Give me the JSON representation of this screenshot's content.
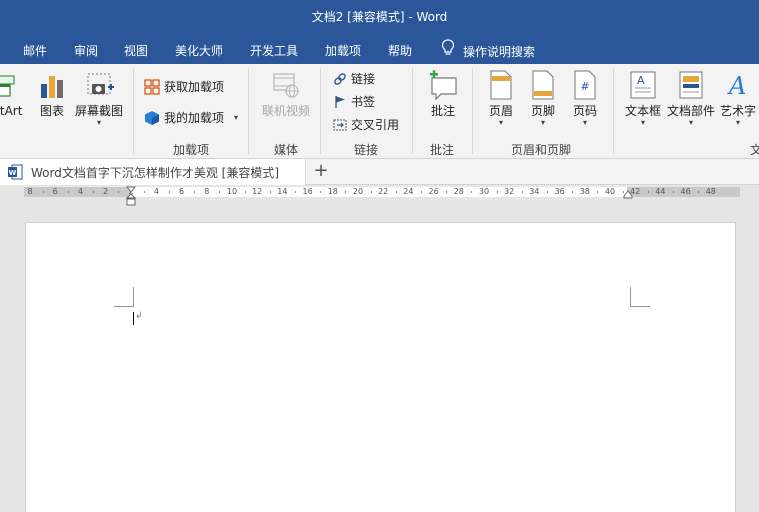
{
  "titlebar": {
    "title": "文档2 [兼容模式]  -  Word"
  },
  "tabs": [
    "邮件",
    "审阅",
    "视图",
    "美化大师",
    "开发工具",
    "加载项",
    "帮助"
  ],
  "tell_me": "操作说明搜索",
  "ribbon": {
    "smartart_partial": "artArt",
    "chart": "图表",
    "screenshot": "屏幕截图",
    "get_addins": "获取加载项",
    "my_addins": "我的加载项",
    "group_addins": "加载项",
    "online_video": "联机视频",
    "group_media": "媒体",
    "link": "链接",
    "bookmark": "书签",
    "cross_reference": "交叉引用",
    "group_links": "链接",
    "comment": "批注",
    "group_comments": "批注",
    "header": "页眉",
    "footer": "页脚",
    "page_number": "页码",
    "group_header_footer": "页眉和页脚",
    "textbox": "文本框",
    "quick_parts": "文档部件",
    "wordart": "艺术字",
    "group_text_partial": "文"
  },
  "document_tab": {
    "label": "Word文档首字下沉怎样制作才美观 [兼容模式]",
    "add": "+"
  },
  "ruler_labels": [
    "8",
    "6",
    "4",
    "2",
    "2",
    "4",
    "6",
    "8",
    "10",
    "12",
    "14",
    "16",
    "18",
    "20",
    "22",
    "24",
    "26",
    "28",
    "30",
    "32",
    "34",
    "36",
    "38",
    "40",
    "42",
    "44",
    "46",
    "48"
  ],
  "colors": {
    "accent": "#2b579a",
    "ribbon_bg": "#f3f3f3",
    "workspace": "#e6e6e6",
    "icon_blue": "#2b579a"
  }
}
